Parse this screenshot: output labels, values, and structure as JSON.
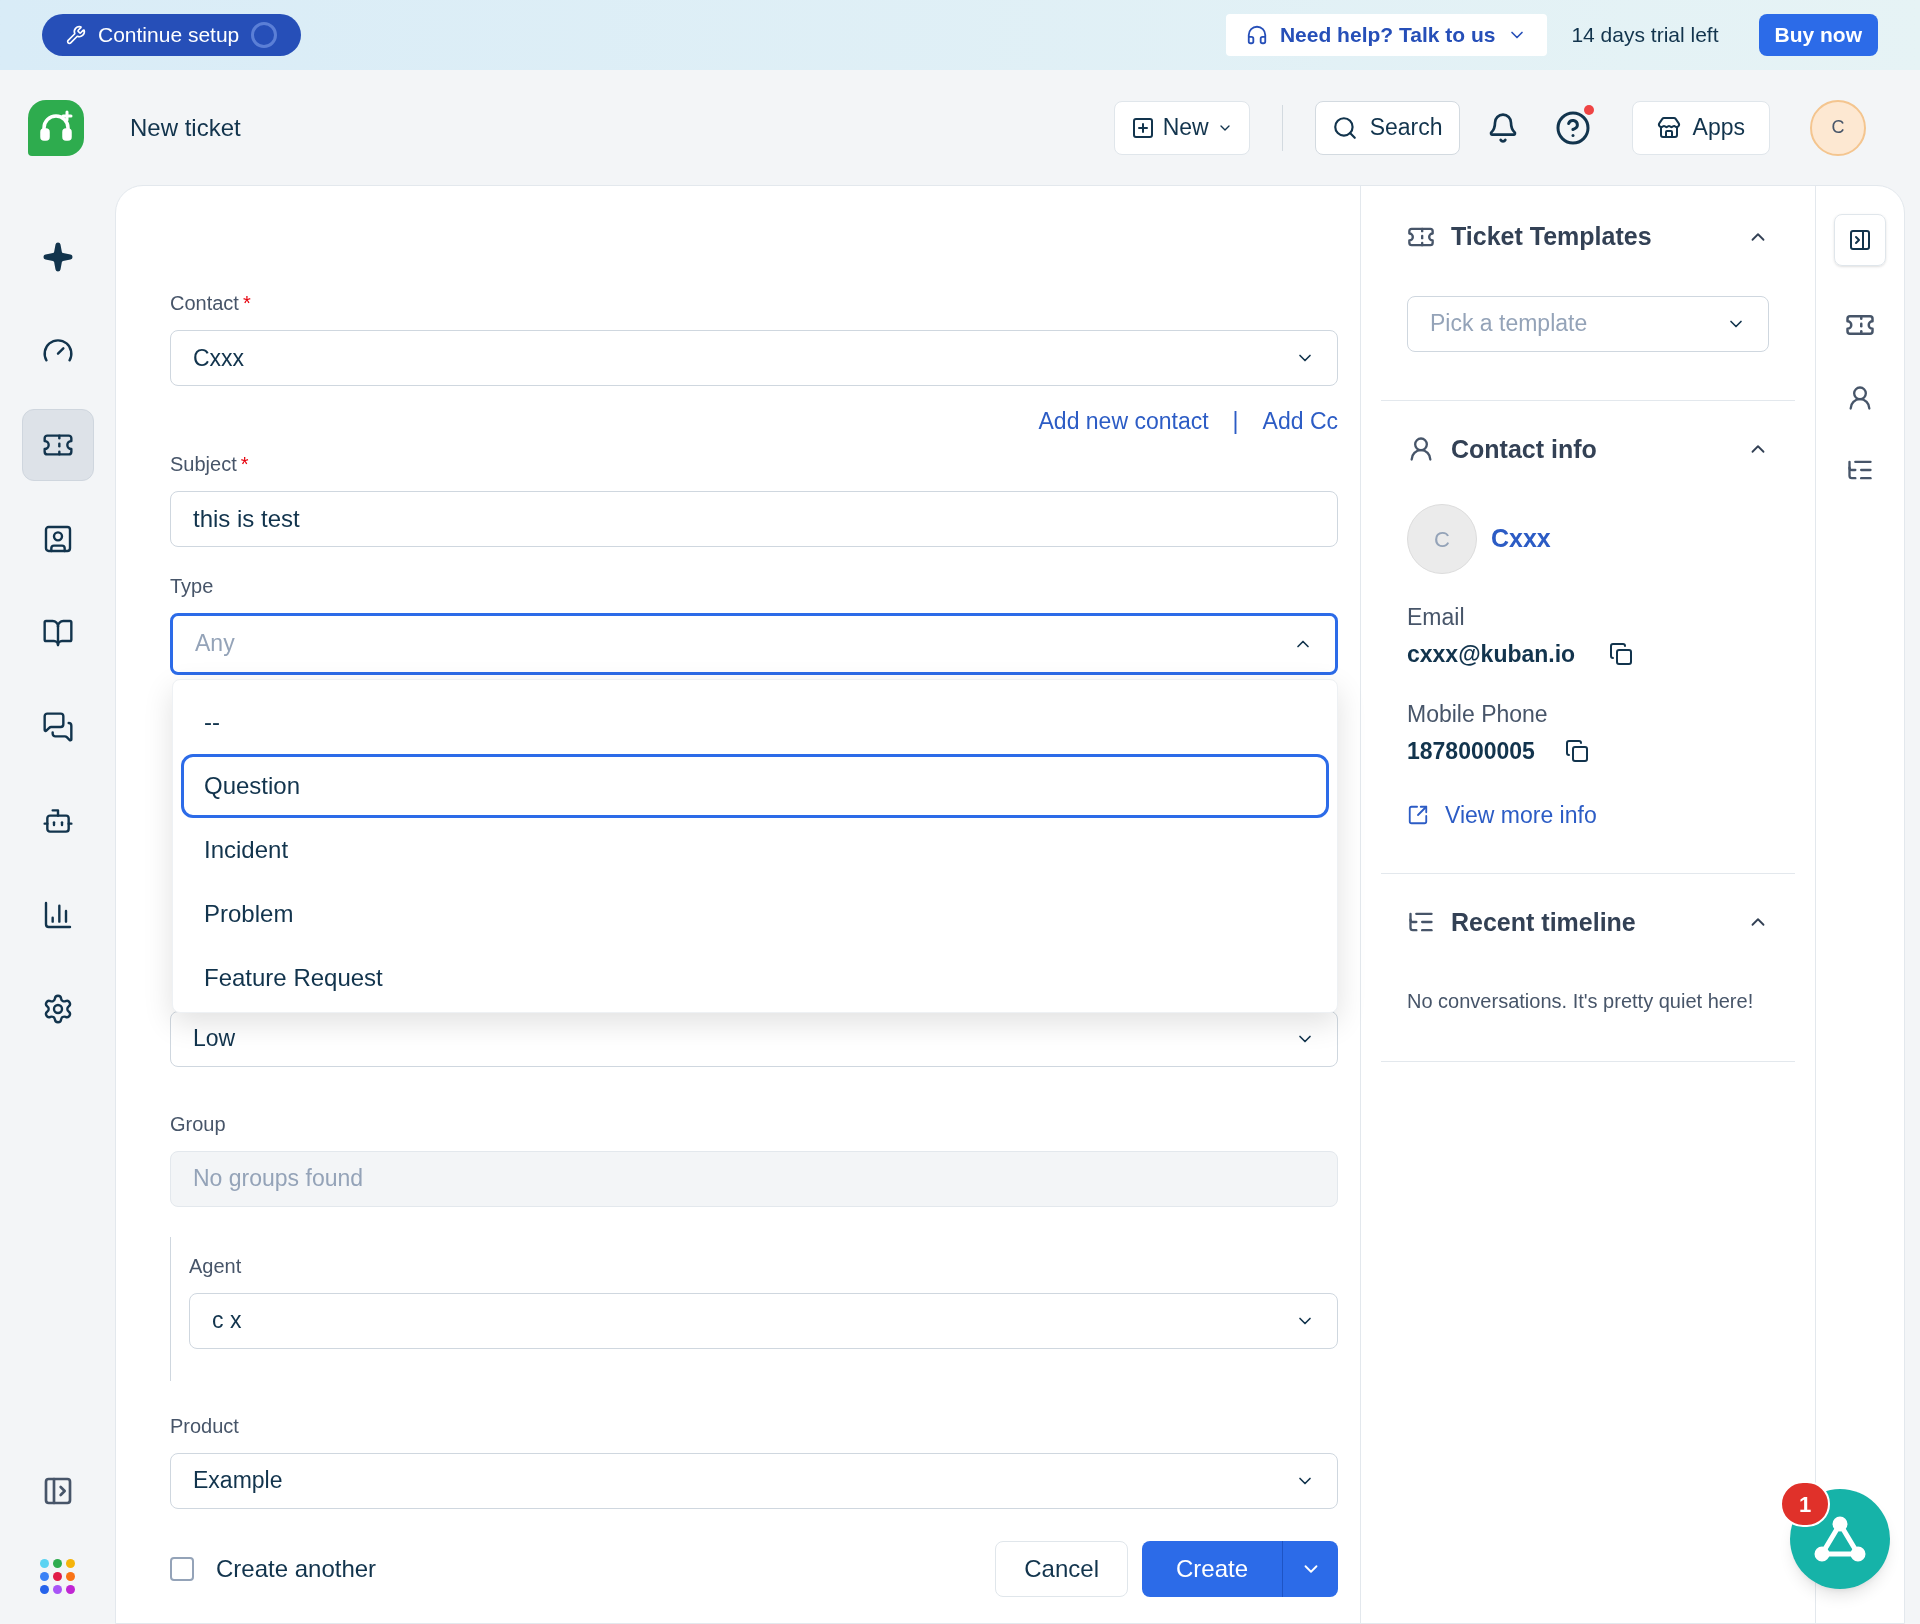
{
  "top_banner": {
    "setup_button": "Continue setup",
    "help_button": "Need help? Talk to us",
    "trial": "14 days trial left",
    "buy_button": "Buy now"
  },
  "header": {
    "title": "New ticket",
    "new_button": "New",
    "search_button": "Search",
    "apps_button": "Apps",
    "avatar": "C"
  },
  "sidebar": {
    "items": [
      {
        "kind": "sparkle",
        "selected": false
      },
      {
        "kind": "gauge",
        "selected": false
      },
      {
        "kind": "ticket",
        "selected": true
      },
      {
        "kind": "contact",
        "selected": false
      },
      {
        "kind": "book",
        "selected": false
      },
      {
        "kind": "chat",
        "selected": false
      },
      {
        "kind": "bot",
        "selected": false
      },
      {
        "kind": "chart",
        "selected": false
      },
      {
        "kind": "settings",
        "selected": false
      }
    ]
  },
  "form": {
    "contact": {
      "label": "Contact",
      "required_mark": "*",
      "value": "Cxxx"
    },
    "links": [
      "Add new contact",
      "|",
      "Add Cc"
    ],
    "subject": {
      "label": "Subject",
      "required_mark": "*",
      "value": "this is test"
    },
    "type": {
      "label": "Type",
      "placeholder": "Any",
      "expanded": true,
      "options": [
        {
          "label": "--",
          "selected": false
        },
        {
          "label": "Question",
          "selected": true
        },
        {
          "label": "Incident",
          "selected": false
        },
        {
          "label": "Problem",
          "selected": false
        },
        {
          "label": "Feature Request",
          "selected": false
        }
      ]
    },
    "priority": {
      "value": "Low"
    },
    "group": {
      "label": "Group",
      "placeholder": "No groups found",
      "disabled": true
    },
    "agent": {
      "label": "Agent",
      "value": "c x"
    },
    "product": {
      "label": "Product",
      "value": "Example"
    },
    "create_another": {
      "label": "Create another",
      "checked": false
    },
    "cancel_button": "Cancel",
    "create_button": "Create"
  },
  "right_panel": {
    "templates": {
      "title": "Ticket Templates",
      "placeholder": "Pick a template",
      "expanded": true
    },
    "contact_info": {
      "title": "Contact info",
      "expanded": true,
      "avatar": "C",
      "name": "Cxxx",
      "email_label": "Email",
      "email": "cxxx@kuban.io",
      "phone_label": "Mobile Phone",
      "phone": "1878000005",
      "more_link": "View more info"
    },
    "timeline": {
      "title": "Recent timeline",
      "expanded": true,
      "empty": "No conversations. It's pretty quiet here!"
    }
  },
  "chat_widget": {
    "badge": "1"
  }
}
